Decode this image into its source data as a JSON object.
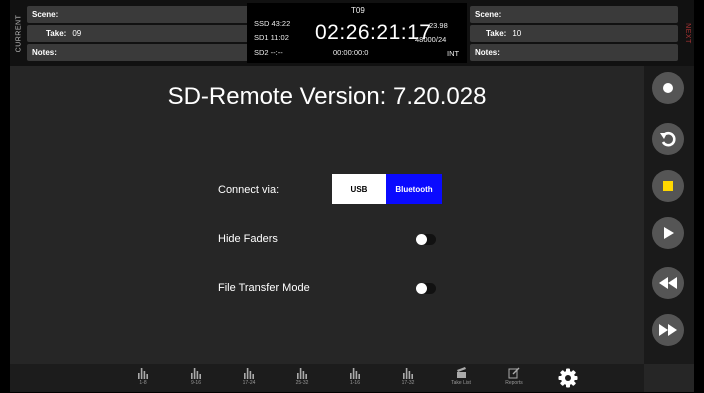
{
  "header": {
    "left_side_label": "CURRENT",
    "right_side_label": "NEXT",
    "current": {
      "scene_label": "Scene:",
      "scene_value": "",
      "take_label": "Take:",
      "take_value": "09",
      "notes_label": "Notes:",
      "notes_value": ""
    },
    "next": {
      "scene_label": "Scene:",
      "scene_value": "",
      "take_label": "Take:",
      "take_value": "10",
      "notes_label": "Notes:",
      "notes_value": ""
    },
    "timecode": {
      "take_name": "T09",
      "ssd": "SSD 43:22",
      "sd1": "SD1 11:02",
      "sd2": "SD2 --:--",
      "main": "02:26:21:17",
      "frame_rate": "23.98",
      "sample_rate": "48000/24",
      "sub_timecode": "00:00:00:0",
      "tc_source": "INT"
    }
  },
  "main": {
    "title": "SD-Remote Version: 7.20.028",
    "connect_label": "Connect via:",
    "usb_label": "USB",
    "bluetooth_label": "Bluetooth",
    "selected_connection": "Bluetooth",
    "hide_faders_label": "Hide Faders",
    "hide_faders_on": false,
    "file_transfer_label": "File Transfer Mode",
    "file_transfer_on": false
  },
  "transport": [
    {
      "name": "record",
      "icon": "record-icon"
    },
    {
      "name": "undo",
      "icon": "undo-icon"
    },
    {
      "name": "stop",
      "icon": "stop-icon"
    },
    {
      "name": "play",
      "icon": "play-icon"
    },
    {
      "name": "rewind",
      "icon": "rewind-icon"
    },
    {
      "name": "fast-forward",
      "icon": "fast-forward-icon"
    }
  ],
  "bottom_tabs": [
    {
      "label": "1-8",
      "icon": "fader-bank-icon"
    },
    {
      "label": "9-16",
      "icon": "fader-bank-icon"
    },
    {
      "label": "17-24",
      "icon": "fader-bank-icon"
    },
    {
      "label": "25-32",
      "icon": "fader-bank-icon"
    },
    {
      "label": "1-16",
      "icon": "fader-bank-icon"
    },
    {
      "label": "17-32",
      "icon": "fader-bank-icon"
    },
    {
      "label": "Take List",
      "icon": "clapper-icon"
    },
    {
      "label": "Reports",
      "icon": "edit-icon"
    }
  ],
  "colors": {
    "background": "#262626",
    "bluetooth_active": "#0a0aff",
    "stop_accent": "#ffd800",
    "next_label": "#aa3333"
  }
}
